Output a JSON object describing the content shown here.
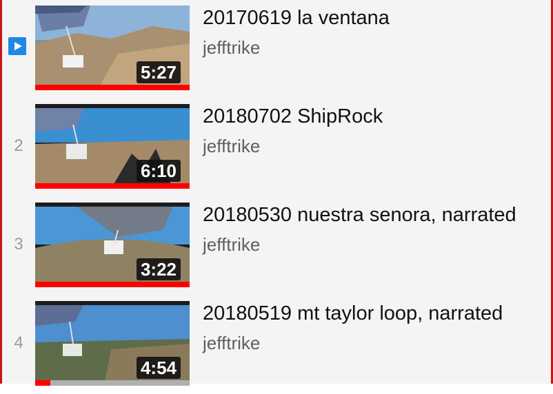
{
  "playlist": {
    "items": [
      {
        "index": "",
        "playing": true,
        "title": "20170619 la ventana",
        "channel": "jefftrike",
        "duration": "5:27",
        "progress": 1.0,
        "sky": "#7fa8cf",
        "ground": "#9b8768"
      },
      {
        "index": "2",
        "playing": false,
        "title": "20180702 ShipRock",
        "channel": "jefftrike",
        "duration": "6:10",
        "progress": 1.0,
        "sky": "#3a8fd0",
        "ground": "#a58a6a"
      },
      {
        "index": "3",
        "playing": false,
        "title": "20180530 nuestra senora, narrated",
        "channel": "jefftrike",
        "duration": "3:22",
        "progress": 1.0,
        "sky": "#4a96d6",
        "ground": "#8f8263"
      },
      {
        "index": "4",
        "playing": false,
        "title": "20180519 mt taylor loop, narrated",
        "channel": "jefftrike",
        "duration": "4:54",
        "progress": 0.1,
        "sky": "#4d8fcf",
        "ground": "#5e6c4a"
      }
    ]
  },
  "colors": {
    "accent_border": "#c4161c",
    "progress_red": "#ff0000",
    "now_playing_blue": "#1e88e5"
  }
}
